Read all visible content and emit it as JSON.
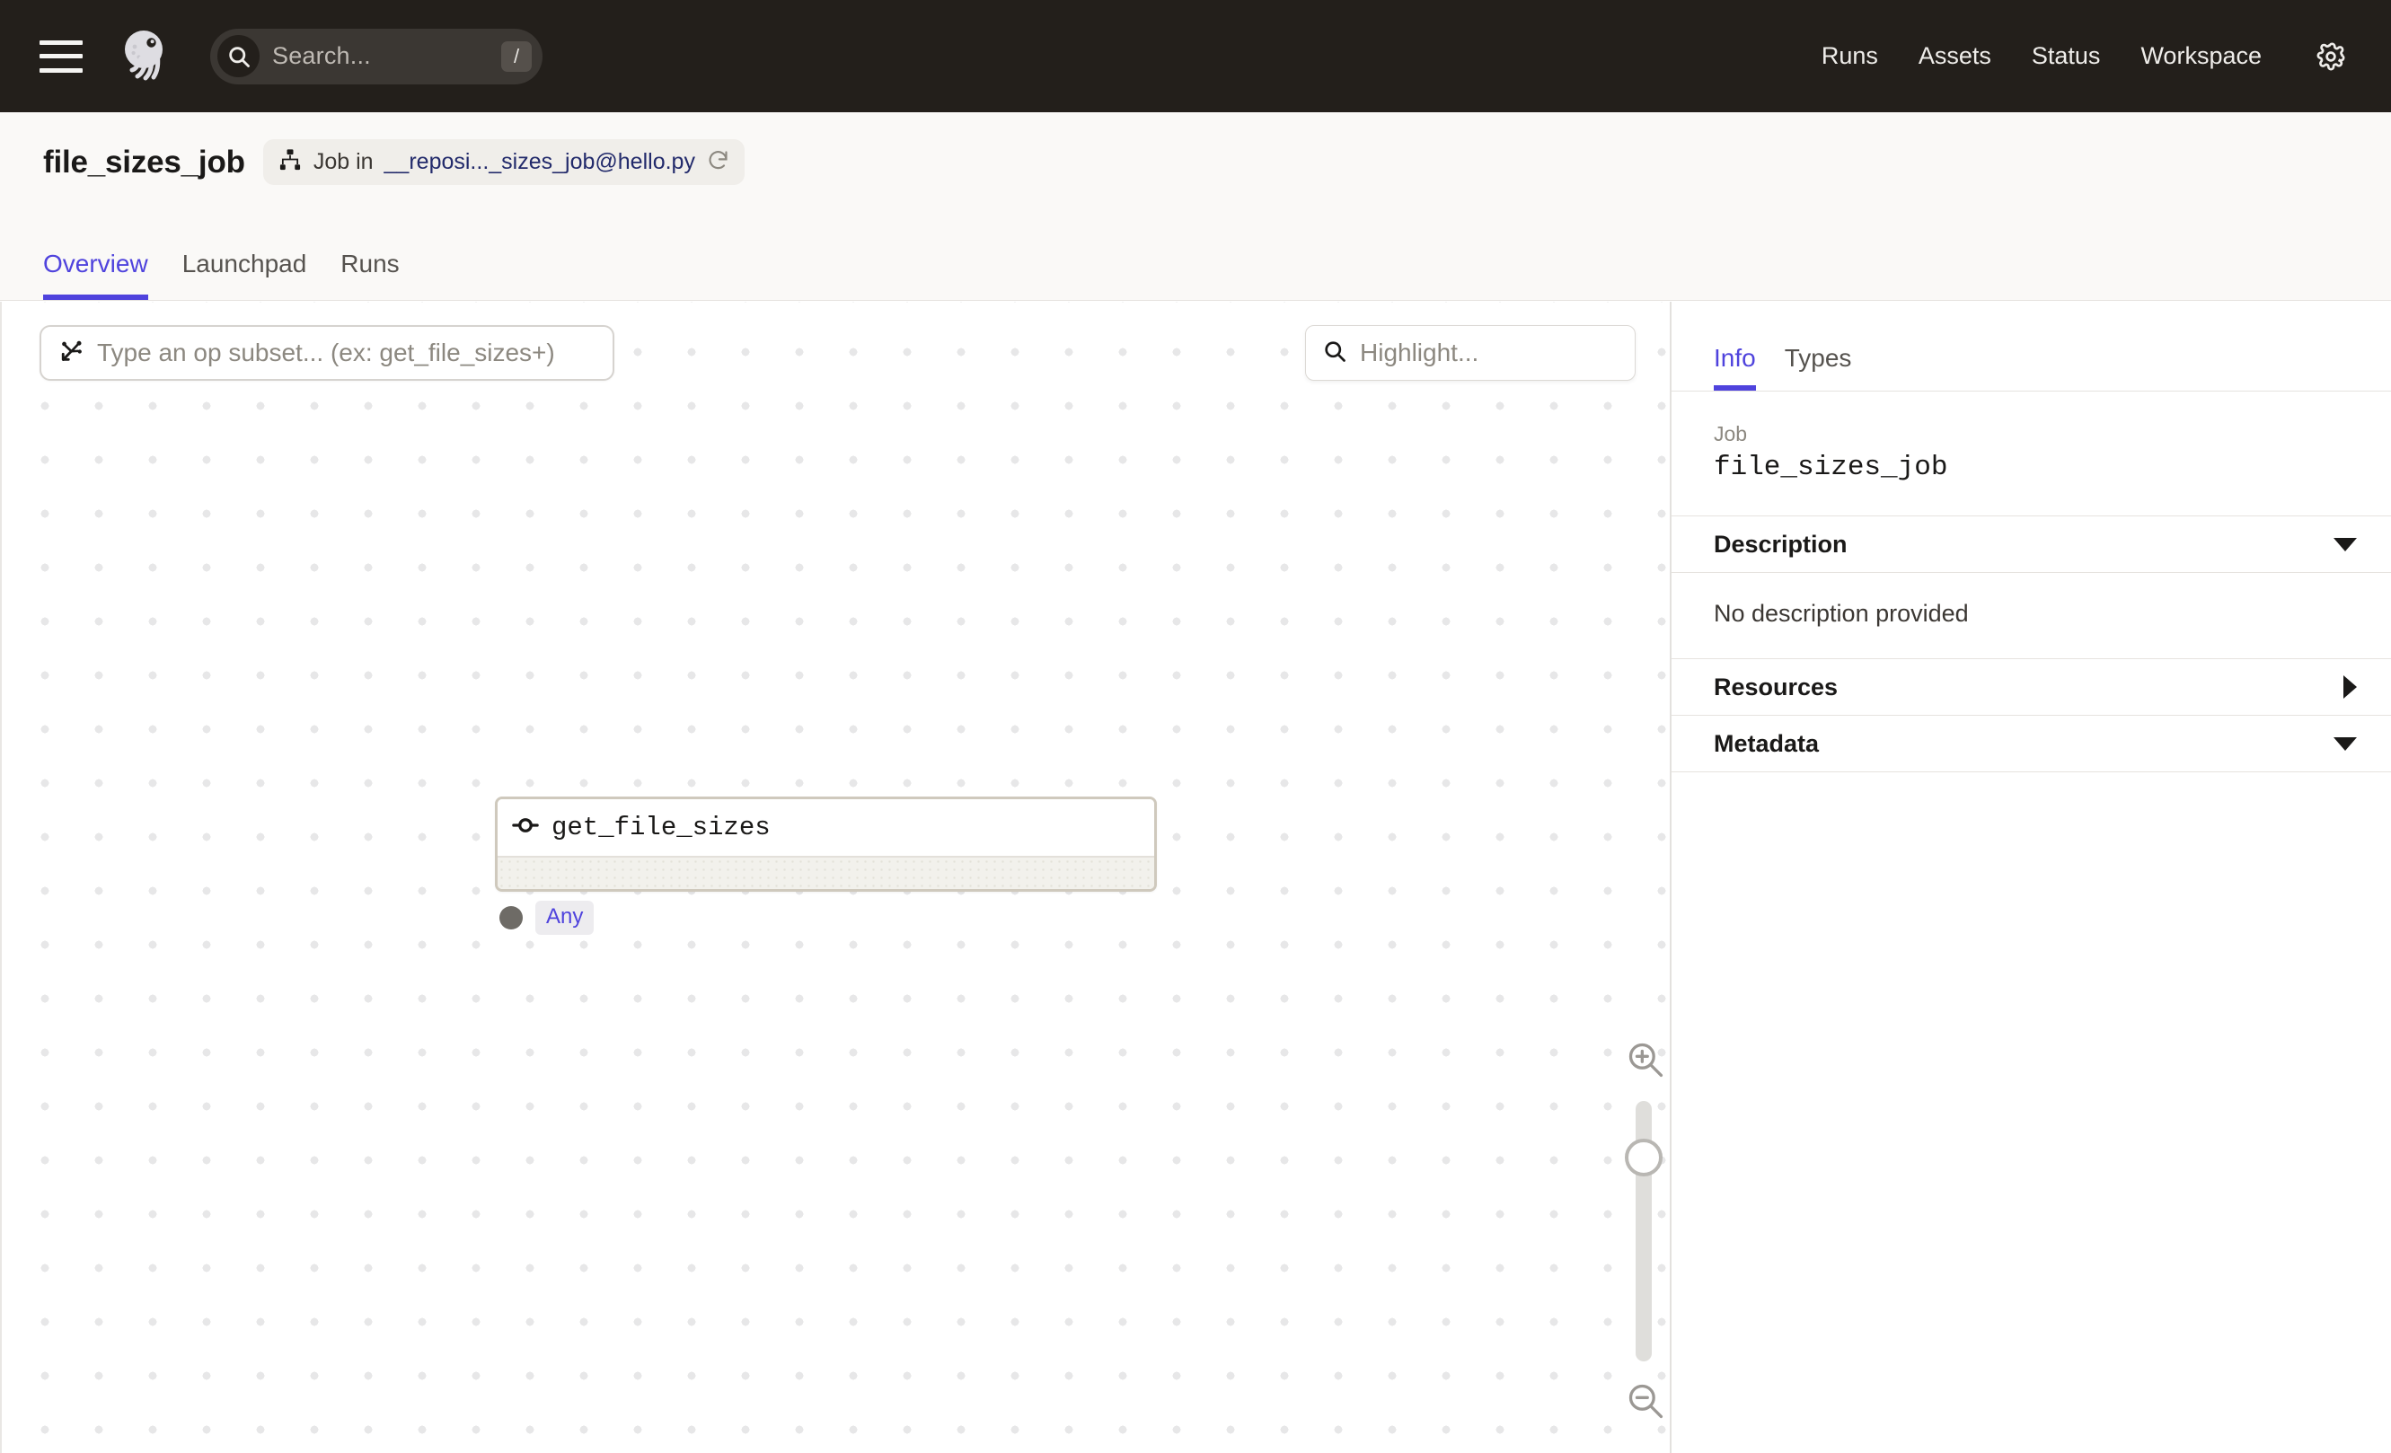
{
  "topnav": {
    "menu_icon": "hamburger-menu-icon",
    "logo_icon": "dagster-logo-icon",
    "search": {
      "icon": "search-icon",
      "placeholder": "Search...",
      "shortcut_key": "/"
    },
    "links": [
      {
        "label": "Runs"
      },
      {
        "label": "Assets"
      },
      {
        "label": "Status"
      },
      {
        "label": "Workspace"
      }
    ],
    "settings_icon": "gear-icon",
    "background_color": "#231F1B"
  },
  "header": {
    "title": "file_sizes_job",
    "breadcrumb": {
      "icon": "job-graph-icon",
      "prefix": "Job in",
      "location": "__reposi..._sizes_job@hello.py",
      "refresh_icon": "refresh-icon"
    },
    "tabs": [
      {
        "label": "Overview",
        "active": true
      },
      {
        "label": "Launchpad",
        "active": false
      },
      {
        "label": "Runs",
        "active": false
      }
    ],
    "accent_color": "#4F43DD"
  },
  "graph": {
    "op_subset_input": {
      "icon": "op-subset-icon",
      "placeholder": "Type an op subset... (ex: get_file_sizes+)",
      "value": ""
    },
    "highlight_input": {
      "icon": "search-icon",
      "placeholder": "Highlight...",
      "value": ""
    },
    "nodes": [
      {
        "name": "get_file_sizes",
        "icon": "op-node-icon",
        "output": {
          "connector_icon": "output-connector-dot",
          "type_label": "Any"
        }
      }
    ],
    "zoom_controls": {
      "zoom_in_icon": "zoom-in-icon",
      "zoom_out_icon": "zoom-out-icon",
      "slider_handle_icon": "zoom-slider-handle"
    }
  },
  "sidebar": {
    "tabs": [
      {
        "label": "Info",
        "active": true
      },
      {
        "label": "Types",
        "active": false
      }
    ],
    "job": {
      "label": "Job",
      "value": "file_sizes_job"
    },
    "sections": [
      {
        "title": "Description",
        "expanded": true,
        "caret_icon": "caret-down-icon",
        "body": "No description provided"
      },
      {
        "title": "Resources",
        "expanded": false,
        "caret_icon": "caret-right-icon",
        "body": ""
      },
      {
        "title": "Metadata",
        "expanded": true,
        "caret_icon": "caret-down-icon",
        "body": ""
      }
    ]
  }
}
